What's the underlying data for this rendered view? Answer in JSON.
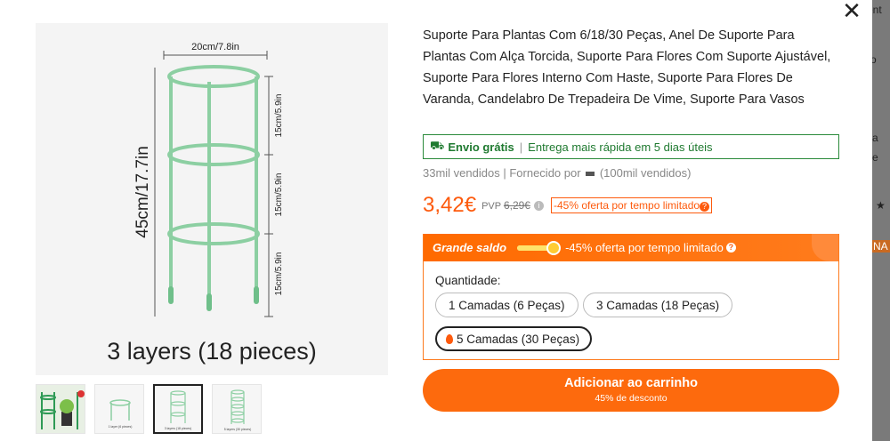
{
  "background_strip": {
    "fragments": [
      "ent",
      "o",
      "a",
      "e",
      "★",
      "NA"
    ]
  },
  "close_icon": "close-icon",
  "image": {
    "width_label": "20cm/7.8in",
    "height_label": "45cm/17.7in",
    "segment_labels": [
      "15cm/5.9in",
      "15cm/5.9in",
      "15cm/5.9in"
    ],
    "caption": "3 layers (18 pieces)",
    "thumbs": [
      {
        "name": "thumb-1"
      },
      {
        "name": "thumb-2",
        "caption": "1 layer (6 pieces)"
      },
      {
        "name": "thumb-3",
        "caption": "3 layers (18 pieces)"
      },
      {
        "name": "thumb-4",
        "caption": "5 layers (30 pieces)"
      }
    ]
  },
  "product": {
    "title": "Suporte Para Plantas Com 6/18/30 Peças, Anel De Suporte Para Plantas Com Alça Torcida, Suporte Para Flores Com Suporte Ajustável, Suporte Para Flores Interno Com Haste, Suporte Para Flores De Varanda, Candelabro De Trepadeira De Vime, Suporte Para Vasos",
    "shipping_label": "Envio grátis",
    "shipping_detail": "Entrega mais rápida em 5 dias úteis",
    "sold": "33mil vendidos",
    "supplied_by": "Fornecido por",
    "supplier_sales": "(100mil vendidos)",
    "price": "3,42€",
    "pvp_label": "PVP",
    "pvp_price": "6,29€",
    "deal": "-45% oferta por tempo limitado"
  },
  "sale": {
    "label": "Grande saldo",
    "text": "-45% oferta por tempo limitado",
    "progress": 0.85
  },
  "quantity": {
    "label": "Quantidade:",
    "options": [
      "1 Camadas (6 Peças)",
      "3 Camadas (18 Peças)",
      "5 Camadas (30 Peças)"
    ],
    "selected": "5 Camadas (30 Peças)"
  },
  "cart": {
    "label": "Adicionar ao carrinho",
    "sub": "45% de desconto"
  },
  "colors": {
    "accent": "#fd5a0d",
    "green": "#2a8a3a",
    "plant_support": "#8ccfa2"
  }
}
